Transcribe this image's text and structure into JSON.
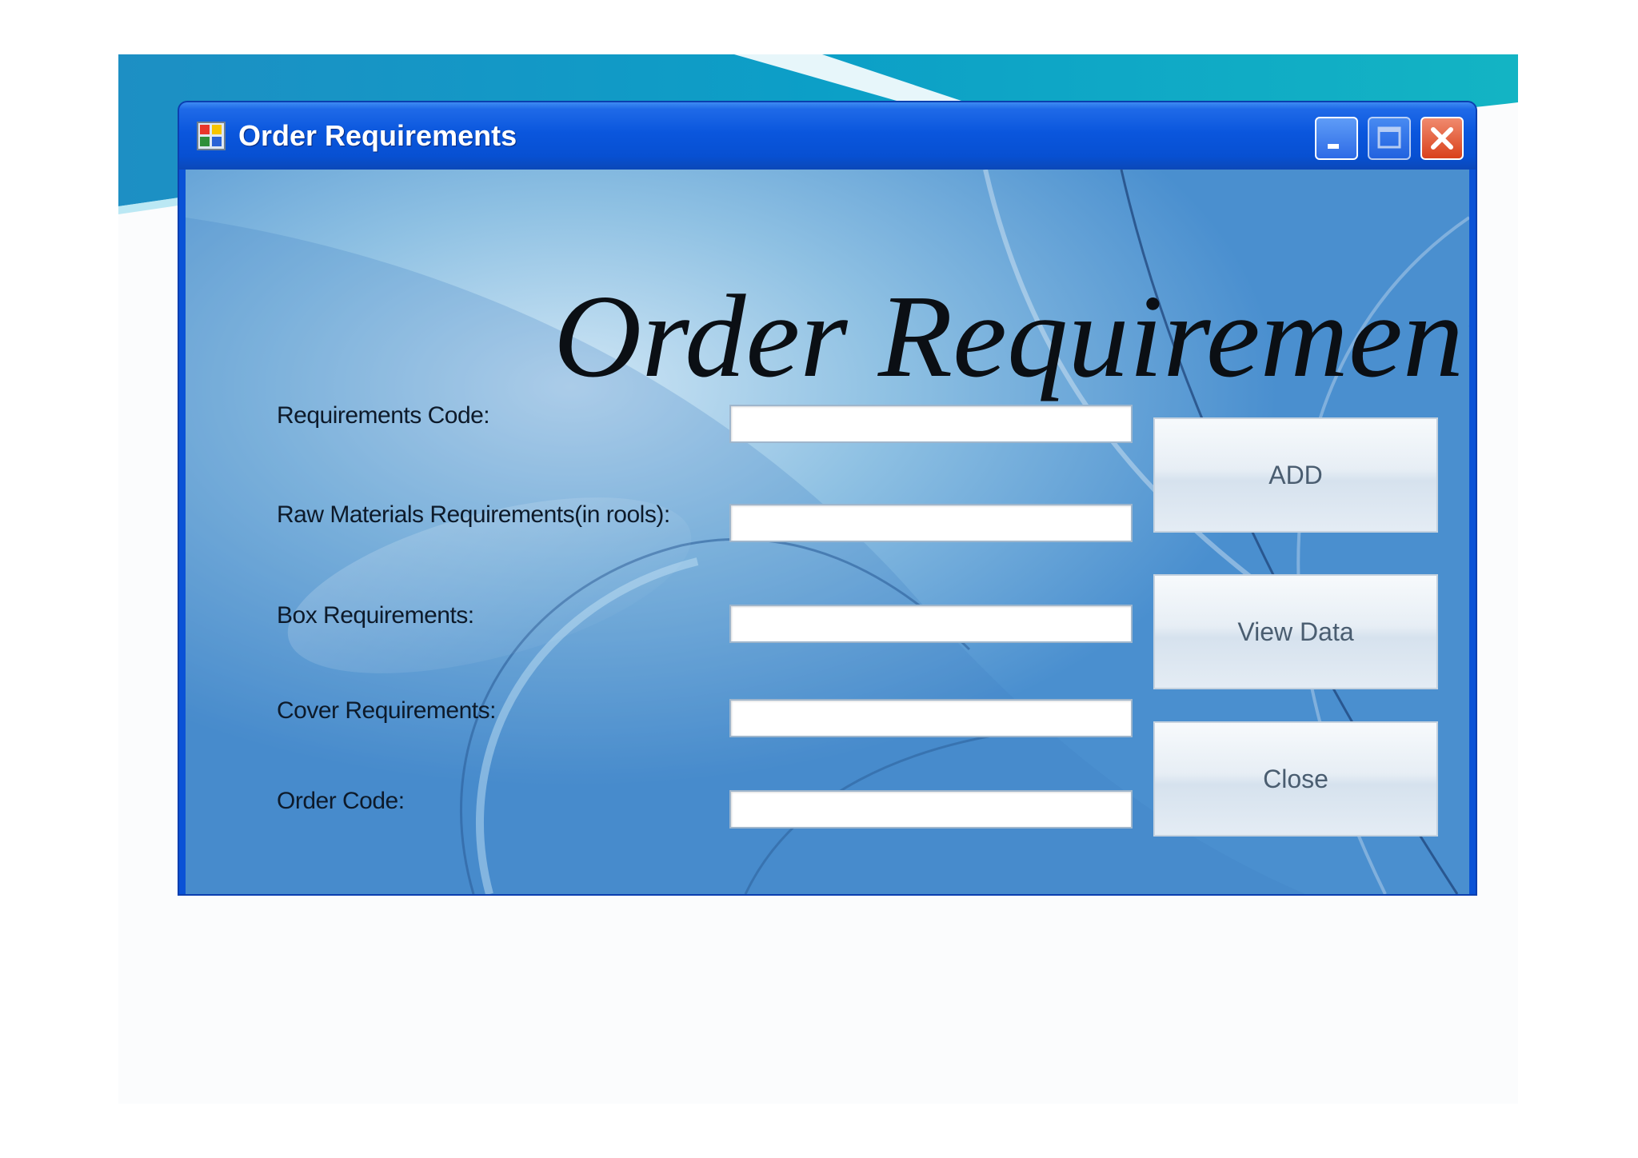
{
  "window": {
    "title": "Order Requirements",
    "controls": {
      "minimize": "minimize",
      "maximize": "maximize",
      "close": "close"
    }
  },
  "form": {
    "heading": "Order Requirements",
    "fields": [
      {
        "label": "Requirements Code:",
        "value": ""
      },
      {
        "label": "Raw Materials Requirements(in rools):",
        "value": ""
      },
      {
        "label": "Box Requirements:",
        "value": ""
      },
      {
        "label": "Cover Requirements:",
        "value": ""
      },
      {
        "label": "Order Code:",
        "value": ""
      }
    ],
    "buttons": {
      "add": "ADD",
      "view_data": "View Data",
      "close": "Close"
    }
  },
  "colors": {
    "titlebar": "#0a56dd",
    "close_button": "#d9411b",
    "background_blue": "#5b9fd6"
  }
}
